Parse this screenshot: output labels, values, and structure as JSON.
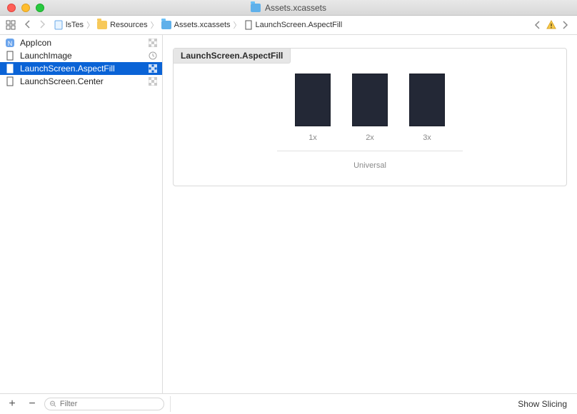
{
  "window": {
    "title": "Assets.xcassets"
  },
  "breadcrumb": {
    "items": [
      {
        "label": "lsTes",
        "icon": "doc-blue"
      },
      {
        "label": "Resources",
        "icon": "folder-yellow"
      },
      {
        "label": "Assets.xcassets",
        "icon": "folder-blue"
      },
      {
        "label": "LaunchScreen.AspectFill",
        "icon": "imageset"
      }
    ]
  },
  "sidebar": {
    "items": [
      {
        "label": "AppIcon",
        "icon": "appicon",
        "trailing": "checkerboard"
      },
      {
        "label": "LaunchImage",
        "icon": "imageset",
        "trailing": "clock"
      },
      {
        "label": "LaunchScreen.AspectFill",
        "icon": "imageset",
        "trailing": "checkerboard",
        "selected": true
      },
      {
        "label": "LaunchScreen.Center",
        "icon": "imageset",
        "trailing": "checkerboard"
      }
    ]
  },
  "detail": {
    "title": "LaunchScreen.AspectFill",
    "scales": [
      "1x",
      "2x",
      "3x"
    ],
    "device_label": "Universal"
  },
  "footer": {
    "filter_placeholder": "Filter",
    "show_slicing": "Show Slicing"
  }
}
